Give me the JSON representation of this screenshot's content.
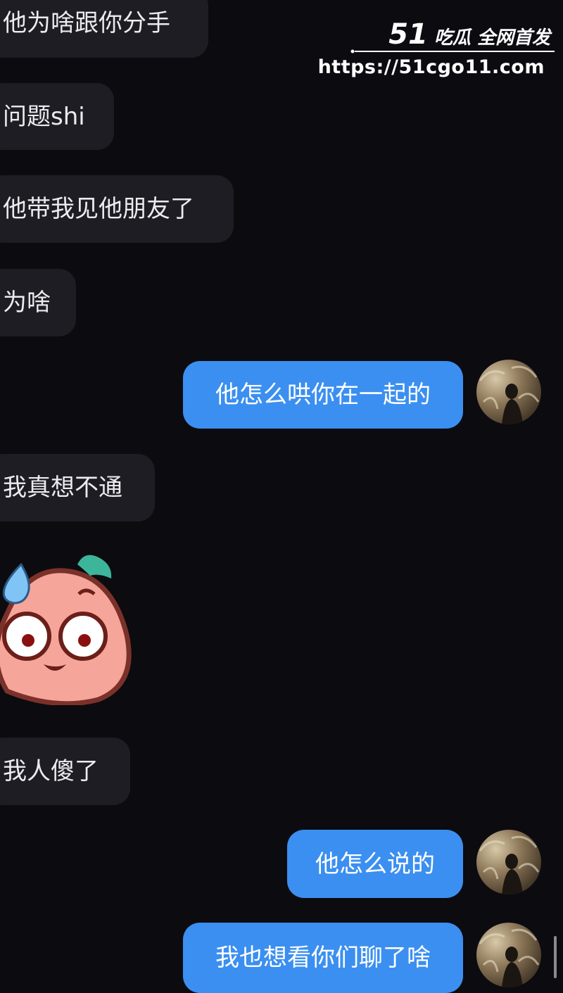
{
  "watermark": {
    "brand_number": "51",
    "brand_text": "吃瓜 全网首发",
    "url": "https://51cgo11.com"
  },
  "messages": [
    {
      "side": "in",
      "text": "他为啥跟你分手"
    },
    {
      "side": "in",
      "text": "问题shi"
    },
    {
      "side": "in",
      "text": "他带我见他朋友了"
    },
    {
      "side": "in",
      "text": "为啥"
    },
    {
      "side": "out",
      "text": "他怎么哄你在一起的"
    },
    {
      "side": "in",
      "text": "我真想不通"
    },
    {
      "side": "in",
      "sticker": "sweating-peach-face-sticker"
    },
    {
      "side": "in",
      "text": "我人傻了"
    },
    {
      "side": "out",
      "text": "他怎么说的"
    },
    {
      "side": "out",
      "text": "我也想看你们聊了啥"
    }
  ],
  "colors": {
    "background": "#0c0b10",
    "incoming_bubble": "#1e1d23",
    "outgoing_bubble": "#3b8ff0"
  }
}
